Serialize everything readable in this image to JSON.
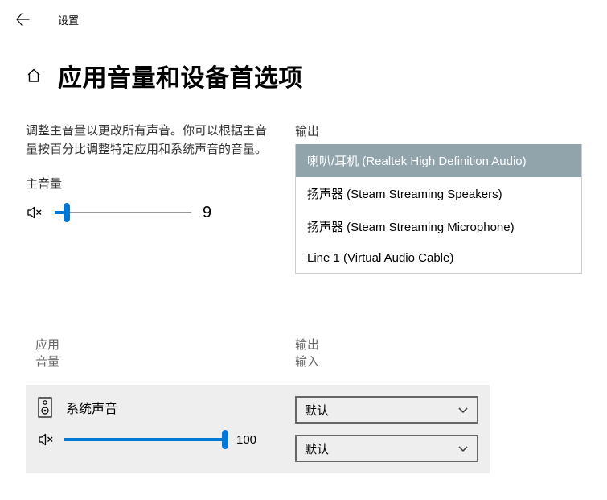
{
  "titlebar": {
    "app_title": "设置"
  },
  "page": {
    "title": "应用音量和设备首选项"
  },
  "left": {
    "description": "调整主音量以更改所有声音。你可以根据主音量按百分比调整特定应用和系统声音的音量。",
    "master_volume_label": "主音量",
    "master_volume_value": "9",
    "master_volume_pct": 9
  },
  "output": {
    "label": "输出",
    "options": [
      {
        "label": "喇叭/耳机 (Realtek High Definition Audio)",
        "selected": true
      },
      {
        "label": "扬声器 (Steam Streaming Speakers)",
        "selected": false
      },
      {
        "label": "扬声器 (Steam Streaming Microphone)",
        "selected": false
      },
      {
        "label": "Line 1 (Virtual Audio Cable)",
        "selected": false
      }
    ]
  },
  "table": {
    "headers": {
      "app": "应用",
      "volume": "音量",
      "output": "输出",
      "input": "输入"
    },
    "rows": [
      {
        "name": "系统声音",
        "volume_value": "100",
        "volume_pct": 100,
        "output_selected": "默认",
        "input_selected": "默认"
      }
    ]
  }
}
